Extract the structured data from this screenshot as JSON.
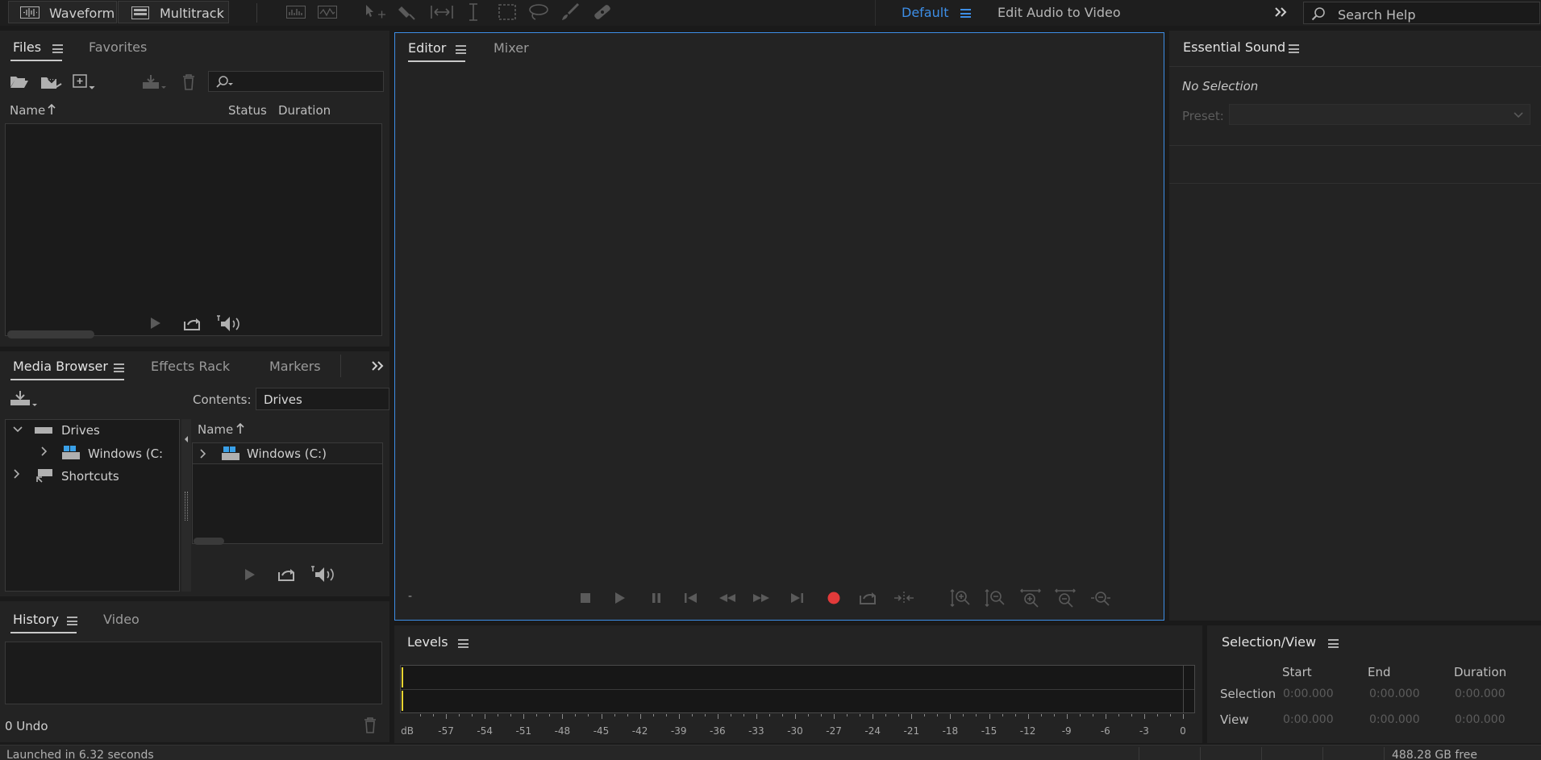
{
  "toolbar": {
    "waveform_label": "Waveform",
    "multitrack_label": "Multitrack",
    "workspace_default": "Default",
    "workspace_edit_audio_video": "Edit Audio to Video",
    "search_placeholder": "Search Help"
  },
  "files_panel": {
    "tabs": [
      "Files",
      "Favorites"
    ],
    "columns": {
      "name": "Name",
      "status": "Status",
      "duration": "Duration"
    }
  },
  "media_browser_panel": {
    "tabs": [
      "Media Browser",
      "Effects Rack",
      "Markers"
    ],
    "contents_label": "Contents:",
    "contents_value": "Drives",
    "tree": {
      "drives": "Drives",
      "windows": "Windows  (C:",
      "shortcuts": "Shortcuts"
    },
    "list_header": "Name",
    "list_items": [
      "Windows  (C:)"
    ]
  },
  "history_panel": {
    "tabs": [
      "History",
      "Video"
    ],
    "undo_count": "0 Undo"
  },
  "editor_panel": {
    "tabs": [
      "Editor",
      "Mixer"
    ],
    "time_display": "-"
  },
  "essential_sound_panel": {
    "title": "Essential Sound",
    "no_selection": "No Selection",
    "preset_label": "Preset:"
  },
  "levels_panel": {
    "title": "Levels",
    "scale": [
      "dB",
      "-57",
      "-54",
      "-51",
      "-48",
      "-45",
      "-42",
      "-39",
      "-36",
      "-33",
      "-30",
      "-27",
      "-24",
      "-21",
      "-18",
      "-15",
      "-12",
      "-9",
      "-6",
      "-3",
      "0"
    ]
  },
  "selection_view_panel": {
    "title": "Selection/View",
    "columns": [
      "Start",
      "End",
      "Duration"
    ],
    "rows": [
      {
        "label": "Selection",
        "start": "0:00.000",
        "end": "0:00.000",
        "duration": "0:00.000"
      },
      {
        "label": "View",
        "start": "0:00.000",
        "end": "0:00.000",
        "duration": "0:00.000"
      }
    ]
  },
  "status_bar": {
    "message": "Launched in 6.32 seconds",
    "disk_free": "488.28 GB free"
  },
  "colors": {
    "accent_blue": "#3d8ee6",
    "record_red": "#e23a3a",
    "level_yellow": "#e8d531"
  }
}
